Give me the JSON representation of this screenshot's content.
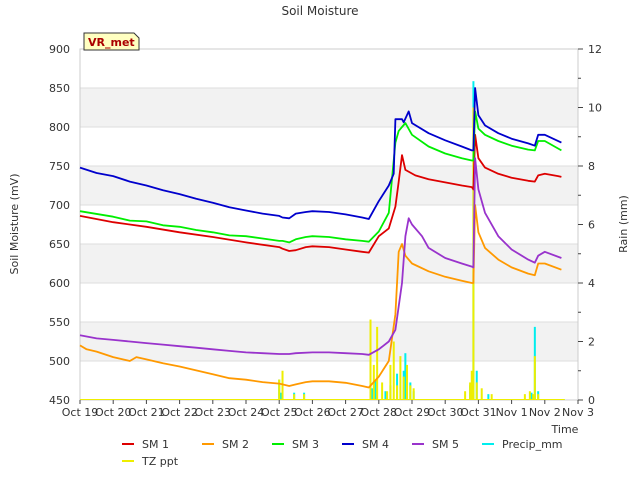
{
  "chart_data": {
    "type": "line",
    "title": "Soil Moisture",
    "xlabel": "Time",
    "ylabel": "Soil Moisture (mV)",
    "y2label": "Rain (mm)",
    "station_badge": "VR_met",
    "xlim": [
      "Oct 19",
      "Nov 3"
    ],
    "xticks": [
      "Oct 19",
      "Oct 20",
      "Oct 21",
      "Oct 22",
      "Oct 23",
      "Oct 24",
      "Oct 25",
      "Oct 26",
      "Oct 27",
      "Oct 28",
      "Oct 29",
      "Oct 30",
      "Oct 31",
      "Nov 1",
      "Nov 2",
      "Nov 3"
    ],
    "ylim": [
      450,
      900
    ],
    "yticks": [
      450,
      500,
      550,
      600,
      650,
      700,
      750,
      800,
      850,
      900
    ],
    "y2lim": [
      0,
      12
    ],
    "y2ticks": [
      0,
      2,
      4,
      6,
      8,
      10,
      12
    ],
    "grid": true,
    "banded_background": true,
    "legend_position": "bottom",
    "series": [
      {
        "name": "SM 1",
        "color": "#dd0000",
        "axis": "left",
        "points": [
          [
            0,
            686
          ],
          [
            1,
            678
          ],
          [
            2,
            672
          ],
          [
            3,
            665
          ],
          [
            4,
            659
          ],
          [
            5,
            652
          ],
          [
            6,
            646
          ],
          [
            6.1,
            644
          ],
          [
            6.3,
            641
          ],
          [
            6.5,
            642
          ],
          [
            6.8,
            646
          ],
          [
            7,
            647
          ],
          [
            7.5,
            646
          ],
          [
            8,
            643
          ],
          [
            8.5,
            640
          ],
          [
            8.7,
            639
          ],
          [
            9,
            660
          ],
          [
            9.3,
            670
          ],
          [
            9.5,
            698
          ],
          [
            9.6,
            730
          ],
          [
            9.7,
            764
          ],
          [
            9.8,
            745
          ],
          [
            10.1,
            738
          ],
          [
            10.5,
            733
          ],
          [
            11,
            729
          ],
          [
            11.5,
            725
          ],
          [
            11.8,
            723
          ],
          [
            11.85,
            720
          ],
          [
            11.9,
            790
          ],
          [
            12,
            760
          ],
          [
            12.2,
            748
          ],
          [
            12.6,
            740
          ],
          [
            13,
            735
          ],
          [
            13.5,
            731
          ],
          [
            13.7,
            730
          ],
          [
            13.8,
            738
          ],
          [
            14,
            740
          ],
          [
            14.4,
            737
          ],
          [
            14.5,
            736
          ]
        ]
      },
      {
        "name": "SM 2",
        "color": "#ff9900",
        "axis": "left",
        "points": [
          [
            0,
            520
          ],
          [
            0.2,
            515
          ],
          [
            0.5,
            512
          ],
          [
            1,
            505
          ],
          [
            1.5,
            500
          ],
          [
            1.7,
            505
          ],
          [
            2,
            502
          ],
          [
            2.5,
            497
          ],
          [
            3,
            493
          ],
          [
            3.5,
            488
          ],
          [
            4,
            483
          ],
          [
            4.5,
            478
          ],
          [
            5,
            476
          ],
          [
            5.5,
            473
          ],
          [
            6,
            471
          ],
          [
            6.1,
            470
          ],
          [
            6.3,
            468
          ],
          [
            6.5,
            470
          ],
          [
            6.8,
            473
          ],
          [
            7,
            474
          ],
          [
            7.5,
            474
          ],
          [
            8,
            472
          ],
          [
            8.5,
            468
          ],
          [
            8.7,
            466
          ],
          [
            9,
            480
          ],
          [
            9.3,
            500
          ],
          [
            9.5,
            560
          ],
          [
            9.6,
            640
          ],
          [
            9.7,
            650
          ],
          [
            9.8,
            635
          ],
          [
            10,
            625
          ],
          [
            10.5,
            615
          ],
          [
            11,
            608
          ],
          [
            11.5,
            603
          ],
          [
            11.8,
            600
          ],
          [
            11.85,
            600
          ],
          [
            11.9,
            700
          ],
          [
            12,
            665
          ],
          [
            12.2,
            645
          ],
          [
            12.6,
            630
          ],
          [
            13,
            620
          ],
          [
            13.5,
            612
          ],
          [
            13.7,
            610
          ],
          [
            13.8,
            625
          ],
          [
            14,
            625
          ],
          [
            14.5,
            617
          ]
        ]
      },
      {
        "name": "SM 3",
        "color": "#00ee00",
        "axis": "left",
        "points": [
          [
            0,
            692
          ],
          [
            1,
            685
          ],
          [
            1.5,
            680
          ],
          [
            2,
            679
          ],
          [
            2.5,
            674
          ],
          [
            3,
            672
          ],
          [
            3.5,
            668
          ],
          [
            4,
            665
          ],
          [
            4.5,
            661
          ],
          [
            5,
            660
          ],
          [
            5.5,
            657
          ],
          [
            6,
            654
          ],
          [
            6.1,
            654
          ],
          [
            6.3,
            652
          ],
          [
            6.5,
            656
          ],
          [
            6.8,
            659
          ],
          [
            7,
            660
          ],
          [
            7.5,
            659
          ],
          [
            8,
            656
          ],
          [
            8.5,
            654
          ],
          [
            8.7,
            653
          ],
          [
            9,
            666
          ],
          [
            9.3,
            690
          ],
          [
            9.5,
            780
          ],
          [
            9.6,
            795
          ],
          [
            9.7,
            800
          ],
          [
            9.8,
            805
          ],
          [
            10,
            790
          ],
          [
            10.5,
            775
          ],
          [
            11,
            766
          ],
          [
            11.5,
            760
          ],
          [
            11.8,
            757
          ],
          [
            11.85,
            757
          ],
          [
            11.9,
            820
          ],
          [
            12,
            798
          ],
          [
            12.2,
            790
          ],
          [
            12.6,
            782
          ],
          [
            13,
            776
          ],
          [
            13.5,
            771
          ],
          [
            13.7,
            770
          ],
          [
            13.8,
            782
          ],
          [
            14,
            782
          ],
          [
            14.5,
            770
          ]
        ]
      },
      {
        "name": "SM 4",
        "color": "#0000cc",
        "axis": "left",
        "points": [
          [
            0,
            748
          ],
          [
            0.5,
            741
          ],
          [
            1,
            737
          ],
          [
            1.5,
            730
          ],
          [
            2,
            725
          ],
          [
            2.5,
            719
          ],
          [
            3,
            714
          ],
          [
            3.5,
            708
          ],
          [
            4,
            703
          ],
          [
            4.5,
            697
          ],
          [
            5,
            693
          ],
          [
            5.5,
            689
          ],
          [
            6,
            686
          ],
          [
            6.1,
            684
          ],
          [
            6.3,
            683
          ],
          [
            6.5,
            689
          ],
          [
            6.8,
            691
          ],
          [
            7,
            692
          ],
          [
            7.5,
            691
          ],
          [
            8,
            688
          ],
          [
            8.5,
            684
          ],
          [
            8.7,
            682
          ],
          [
            9,
            705
          ],
          [
            9.3,
            725
          ],
          [
            9.45,
            740
          ],
          [
            9.5,
            810
          ],
          [
            9.7,
            810
          ],
          [
            9.75,
            806
          ],
          [
            9.9,
            820
          ],
          [
            10,
            805
          ],
          [
            10.5,
            792
          ],
          [
            11,
            783
          ],
          [
            11.5,
            775
          ],
          [
            11.8,
            770
          ],
          [
            11.85,
            770
          ],
          [
            11.9,
            850
          ],
          [
            12,
            815
          ],
          [
            12.2,
            802
          ],
          [
            12.6,
            792
          ],
          [
            13,
            785
          ],
          [
            13.5,
            779
          ],
          [
            13.7,
            776
          ],
          [
            13.8,
            790
          ],
          [
            14,
            790
          ],
          [
            14.5,
            780
          ]
        ]
      },
      {
        "name": "SM 5",
        "color": "#9933cc",
        "axis": "left",
        "points": [
          [
            0,
            533
          ],
          [
            0.5,
            529
          ],
          [
            1,
            527
          ],
          [
            1.5,
            525
          ],
          [
            2,
            523
          ],
          [
            2.5,
            521
          ],
          [
            3,
            519
          ],
          [
            3.5,
            517
          ],
          [
            4,
            515
          ],
          [
            4.5,
            513
          ],
          [
            5,
            511
          ],
          [
            5.5,
            510
          ],
          [
            6,
            509
          ],
          [
            6.3,
            509
          ],
          [
            6.5,
            510
          ],
          [
            7,
            511
          ],
          [
            7.5,
            511
          ],
          [
            8,
            510
          ],
          [
            8.5,
            509
          ],
          [
            8.7,
            508
          ],
          [
            9,
            515
          ],
          [
            9.3,
            525
          ],
          [
            9.5,
            540
          ],
          [
            9.6,
            570
          ],
          [
            9.7,
            600
          ],
          [
            9.8,
            660
          ],
          [
            9.9,
            683
          ],
          [
            10,
            675
          ],
          [
            10.3,
            660
          ],
          [
            10.5,
            645
          ],
          [
            11,
            632
          ],
          [
            11.5,
            625
          ],
          [
            11.8,
            621
          ],
          [
            11.85,
            620
          ],
          [
            11.9,
            760
          ],
          [
            12,
            720
          ],
          [
            12.2,
            690
          ],
          [
            12.6,
            660
          ],
          [
            13,
            643
          ],
          [
            13.5,
            630
          ],
          [
            13.7,
            626
          ],
          [
            13.8,
            635
          ],
          [
            14,
            640
          ],
          [
            14.5,
            632
          ]
        ]
      }
    ],
    "bar_series": [
      {
        "name": "Precip_mm",
        "color": "#00eeee",
        "axis": "right",
        "points": [
          [
            6,
            0.7
          ],
          [
            6.05,
            0.25
          ],
          [
            6.45,
            0.25
          ],
          [
            6.75,
            0.25
          ],
          [
            8.8,
            0.4
          ],
          [
            8.9,
            0.7
          ],
          [
            9.2,
            0.3
          ],
          [
            9.35,
            0.5
          ],
          [
            9.55,
            0.9
          ],
          [
            9.75,
            1.0
          ],
          [
            9.8,
            1.6
          ],
          [
            9.95,
            0.6
          ],
          [
            10.05,
            0.3
          ],
          [
            11.75,
            0.5
          ],
          [
            11.85,
            10.9
          ],
          [
            11.95,
            1.0
          ],
          [
            12.3,
            0.2
          ],
          [
            13.6,
            0.25
          ],
          [
            13.7,
            2.5
          ],
          [
            13.8,
            0.3
          ]
        ]
      },
      {
        "name": "TZ ppt",
        "color": "#eeee00",
        "axis": "right",
        "points": [
          [
            6,
            0.7
          ],
          [
            6.1,
            1.0
          ],
          [
            6.45,
            0.2
          ],
          [
            6.75,
            0.2
          ],
          [
            8.75,
            2.75
          ],
          [
            8.85,
            1.2
          ],
          [
            8.95,
            2.5
          ],
          [
            9.1,
            0.6
          ],
          [
            9.25,
            0.3
          ],
          [
            9.35,
            1.2
          ],
          [
            9.45,
            2.0
          ],
          [
            9.55,
            0.5
          ],
          [
            9.65,
            1.5
          ],
          [
            9.75,
            0.8
          ],
          [
            9.85,
            1.2
          ],
          [
            9.95,
            0.5
          ],
          [
            10.05,
            0.4
          ],
          [
            11.6,
            0.3
          ],
          [
            11.75,
            0.6
          ],
          [
            11.8,
            1.0
          ],
          [
            11.85,
            10.0
          ],
          [
            11.95,
            0.6
          ],
          [
            12.1,
            0.4
          ],
          [
            12.4,
            0.2
          ],
          [
            13.4,
            0.2
          ],
          [
            13.55,
            0.3
          ],
          [
            13.65,
            0.2
          ],
          [
            13.7,
            1.5
          ],
          [
            13.8,
            0.2
          ]
        ]
      }
    ],
    "legend": [
      {
        "label": "SM 1",
        "color": "#dd0000"
      },
      {
        "label": "SM 2",
        "color": "#ff9900"
      },
      {
        "label": "SM 3",
        "color": "#00ee00"
      },
      {
        "label": "SM 4",
        "color": "#0000cc"
      },
      {
        "label": "SM 5",
        "color": "#9933cc"
      },
      {
        "label": "Precip_mm",
        "color": "#00eeee"
      },
      {
        "label": "TZ ppt",
        "color": "#eeee00"
      }
    ]
  }
}
